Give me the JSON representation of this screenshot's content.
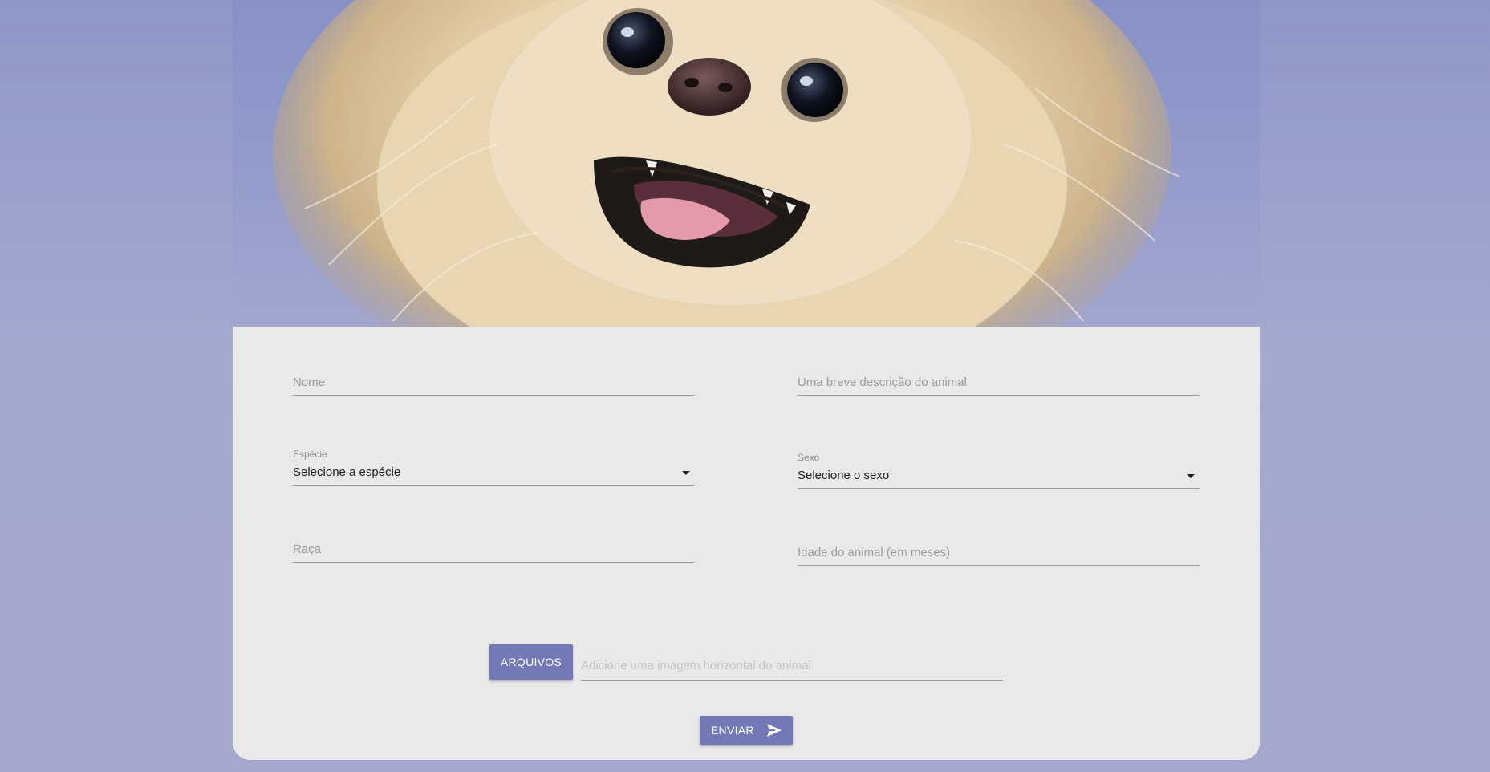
{
  "form": {
    "name_placeholder": "Nome",
    "description_placeholder": "Uma breve descrição do animal",
    "species": {
      "label": "Espécie",
      "selected": "Selecione a espécie"
    },
    "sex": {
      "label": "Sexo",
      "selected": "Selecione o sexo"
    },
    "breed_placeholder": "Raça",
    "age_placeholder": "Idade do animal (em meses)",
    "file": {
      "button_label": "ARQUIVOS",
      "path_placeholder": "Adicione uma imagem horizontal do animal"
    },
    "submit_label": "ENVIAR"
  },
  "colors": {
    "accent": "#7279b6",
    "page_background": "#a3a9cf",
    "card_background": "#e9e9e9"
  },
  "icons": {
    "submit": "send-icon",
    "dropdown": "caret-down-icon"
  }
}
